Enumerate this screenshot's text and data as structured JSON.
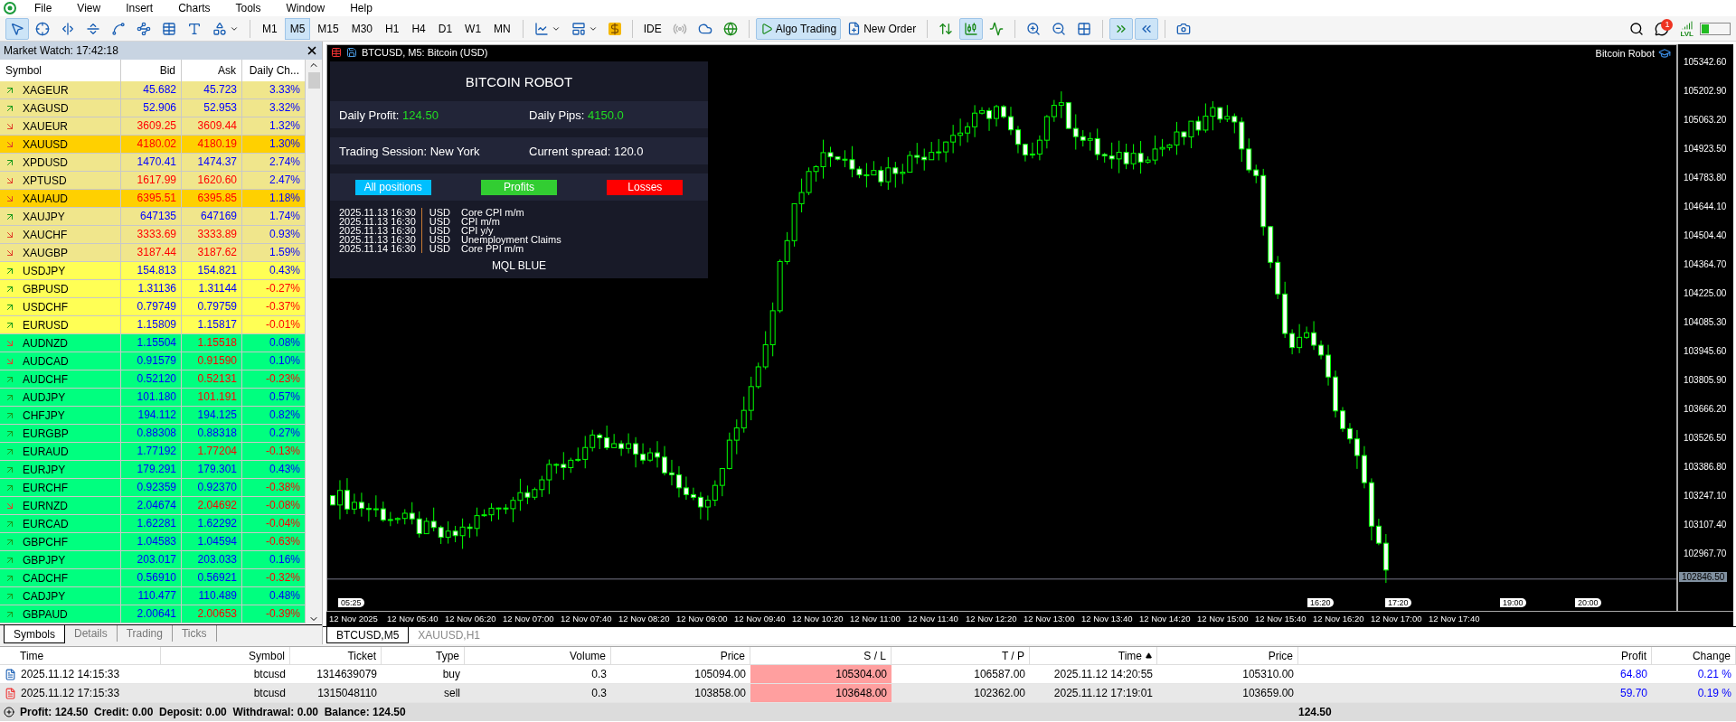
{
  "menu": [
    "File",
    "View",
    "Insert",
    "Charts",
    "Tools",
    "Window",
    "Help"
  ],
  "toolbar": {
    "cursor_selected": true,
    "timeframes": [
      {
        "label": "M1",
        "selected": false
      },
      {
        "label": "M5",
        "selected": true
      },
      {
        "label": "M15",
        "selected": false
      },
      {
        "label": "M30",
        "selected": false
      },
      {
        "label": "H1",
        "selected": false
      },
      {
        "label": "H4",
        "selected": false
      },
      {
        "label": "D1",
        "selected": false
      },
      {
        "label": "W1",
        "selected": false
      },
      {
        "label": "MN",
        "selected": false
      }
    ],
    "ide": "IDE",
    "algo_trading": "Algo Trading",
    "algo_trading_on": true,
    "new_order": "New Order",
    "candles_selected": true,
    "chart_shift": true,
    "autoscroll": true,
    "notification_count": "1",
    "signal_label": "LVL"
  },
  "market_watch": {
    "title": "Market Watch: 17:42:18",
    "columns": [
      "Symbol",
      "Bid",
      "Ask",
      "Daily Ch..."
    ],
    "rows": [
      {
        "symbol": "XAGEUR",
        "rising": true,
        "bid": "45.682",
        "bid_up": true,
        "ask": "45.723",
        "ask_up": true,
        "change": "3.33%",
        "change_up": true,
        "color": "#f0e68c"
      },
      {
        "symbol": "XAGUSD",
        "rising": true,
        "bid": "52.906",
        "bid_up": true,
        "ask": "52.953",
        "ask_up": true,
        "change": "3.32%",
        "change_up": true,
        "color": "#f0e68c"
      },
      {
        "symbol": "XAUEUR",
        "rising": false,
        "bid": "3609.25",
        "bid_up": false,
        "ask": "3609.44",
        "ask_up": false,
        "change": "1.32%",
        "change_up": true,
        "color": "#f0e68c"
      },
      {
        "symbol": "XAUUSD",
        "rising": false,
        "bid": "4180.02",
        "bid_up": false,
        "ask": "4180.19",
        "ask_up": false,
        "change": "1.30%",
        "change_up": true,
        "color": "#ffd000"
      },
      {
        "symbol": "XPDUSD",
        "rising": true,
        "bid": "1470.41",
        "bid_up": true,
        "ask": "1474.37",
        "ask_up": true,
        "change": "2.74%",
        "change_up": true,
        "color": "#f0e68c"
      },
      {
        "symbol": "XPTUSD",
        "rising": false,
        "bid": "1617.99",
        "bid_up": false,
        "ask": "1620.60",
        "ask_up": false,
        "change": "2.47%",
        "change_up": true,
        "color": "#f0e68c"
      },
      {
        "symbol": "XAUAUD",
        "rising": false,
        "bid": "6395.51",
        "bid_up": false,
        "ask": "6395.85",
        "ask_up": false,
        "change": "1.18%",
        "change_up": true,
        "color": "#ffd000"
      },
      {
        "symbol": "XAUJPY",
        "rising": true,
        "bid": "647135",
        "bid_up": true,
        "ask": "647169",
        "ask_up": true,
        "change": "1.74%",
        "change_up": true,
        "color": "#f0e68c"
      },
      {
        "symbol": "XAUCHF",
        "rising": false,
        "bid": "3333.69",
        "bid_up": false,
        "ask": "3333.89",
        "ask_up": false,
        "change": "0.93%",
        "change_up": true,
        "color": "#f0e68c"
      },
      {
        "symbol": "XAUGBP",
        "rising": false,
        "bid": "3187.44",
        "bid_up": false,
        "ask": "3187.62",
        "ask_up": false,
        "change": "1.59%",
        "change_up": true,
        "color": "#f0e68c"
      },
      {
        "symbol": "USDJPY",
        "rising": true,
        "bid": "154.813",
        "bid_up": true,
        "ask": "154.821",
        "ask_up": true,
        "change": "0.43%",
        "change_up": true,
        "color": "#ffff55"
      },
      {
        "symbol": "GBPUSD",
        "rising": true,
        "bid": "1.31136",
        "bid_up": true,
        "ask": "1.31144",
        "ask_up": true,
        "change": "-0.27%",
        "change_up": false,
        "color": "#ffff55"
      },
      {
        "symbol": "USDCHF",
        "rising": true,
        "bid": "0.79749",
        "bid_up": true,
        "ask": "0.79759",
        "ask_up": true,
        "change": "-0.37%",
        "change_up": false,
        "color": "#ffff55"
      },
      {
        "symbol": "EURUSD",
        "rising": true,
        "bid": "1.15809",
        "bid_up": true,
        "ask": "1.15817",
        "ask_up": true,
        "change": "-0.01%",
        "change_up": false,
        "color": "#ffff55"
      },
      {
        "symbol": "AUDNZD",
        "rising": false,
        "bid": "1.15504",
        "bid_up": true,
        "ask": "1.15518",
        "ask_up": false,
        "change": "0.08%",
        "change_up": true,
        "color": "#00ff7f"
      },
      {
        "symbol": "AUDCAD",
        "rising": false,
        "bid": "0.91579",
        "bid_up": true,
        "ask": "0.91590",
        "ask_up": false,
        "change": "0.10%",
        "change_up": true,
        "color": "#00ff7f"
      },
      {
        "symbol": "AUDCHF",
        "rising": true,
        "bid": "0.52120",
        "bid_up": true,
        "ask": "0.52131",
        "ask_up": false,
        "change": "-0.23%",
        "change_up": false,
        "color": "#00ff7f"
      },
      {
        "symbol": "AUDJPY",
        "rising": true,
        "bid": "101.180",
        "bid_up": true,
        "ask": "101.191",
        "ask_up": false,
        "change": "0.57%",
        "change_up": true,
        "color": "#00ff7f"
      },
      {
        "symbol": "CHFJPY",
        "rising": true,
        "bid": "194.112",
        "bid_up": true,
        "ask": "194.125",
        "ask_up": true,
        "change": "0.82%",
        "change_up": true,
        "color": "#00ff7f"
      },
      {
        "symbol": "EURGBP",
        "rising": true,
        "bid": "0.88308",
        "bid_up": true,
        "ask": "0.88318",
        "ask_up": true,
        "change": "0.27%",
        "change_up": true,
        "color": "#00ff7f"
      },
      {
        "symbol": "EURAUD",
        "rising": true,
        "bid": "1.77192",
        "bid_up": true,
        "ask": "1.77204",
        "ask_up": false,
        "change": "-0.13%",
        "change_up": false,
        "color": "#00ff7f"
      },
      {
        "symbol": "EURJPY",
        "rising": true,
        "bid": "179.291",
        "bid_up": true,
        "ask": "179.301",
        "ask_up": true,
        "change": "0.43%",
        "change_up": true,
        "color": "#00ff7f"
      },
      {
        "symbol": "EURCHF",
        "rising": true,
        "bid": "0.92359",
        "bid_up": true,
        "ask": "0.92370",
        "ask_up": true,
        "change": "-0.38%",
        "change_up": false,
        "color": "#00ff7f"
      },
      {
        "symbol": "EURNZD",
        "rising": false,
        "bid": "2.04674",
        "bid_up": true,
        "ask": "2.04692",
        "ask_up": false,
        "change": "-0.08%",
        "change_up": false,
        "color": "#00ff7f"
      },
      {
        "symbol": "EURCAD",
        "rising": true,
        "bid": "1.62281",
        "bid_up": true,
        "ask": "1.62292",
        "ask_up": true,
        "change": "-0.04%",
        "change_up": false,
        "color": "#00ff7f"
      },
      {
        "symbol": "GBPCHF",
        "rising": true,
        "bid": "1.04583",
        "bid_up": true,
        "ask": "1.04594",
        "ask_up": true,
        "change": "-0.63%",
        "change_up": false,
        "color": "#00ff7f"
      },
      {
        "symbol": "GBPJPY",
        "rising": true,
        "bid": "203.017",
        "bid_up": true,
        "ask": "203.033",
        "ask_up": true,
        "change": "0.16%",
        "change_up": true,
        "color": "#00ff7f"
      },
      {
        "symbol": "CADCHF",
        "rising": true,
        "bid": "0.56910",
        "bid_up": true,
        "ask": "0.56921",
        "ask_up": true,
        "change": "-0.32%",
        "change_up": false,
        "color": "#00ff7f"
      },
      {
        "symbol": "CADJPY",
        "rising": true,
        "bid": "110.477",
        "bid_up": true,
        "ask": "110.489",
        "ask_up": true,
        "change": "0.48%",
        "change_up": true,
        "color": "#00ff7f"
      },
      {
        "symbol": "GBPAUD",
        "rising": true,
        "bid": "2.00641",
        "bid_up": true,
        "ask": "2.00653",
        "ask_up": false,
        "change": "-0.39%",
        "change_up": false,
        "color": "#00ff7f"
      }
    ],
    "tabs": [
      {
        "label": "Symbols",
        "selected": true
      },
      {
        "label": "Details",
        "selected": false
      },
      {
        "label": "Trading",
        "selected": false
      },
      {
        "label": "Ticks",
        "selected": false
      }
    ]
  },
  "chart": {
    "title": "BTCUSD, M5:  Bitcoin (USD)",
    "robot_label": "Bitcoin Robot",
    "price_axis": [
      "105342.60",
      "105202.90",
      "105063.20",
      "104923.50",
      "104783.80",
      "104644.10",
      "104504.40",
      "104364.70",
      "104225.00",
      "104085.30",
      "103945.60",
      "103805.90",
      "103666.20",
      "103526.50",
      "103386.80",
      "103247.10",
      "103107.40",
      "102967.70"
    ],
    "current_price": "102846.50",
    "time_axis": [
      "12 Nov 2025",
      "12 Nov 05:40",
      "12 Nov 06:20",
      "12 Nov 07:00",
      "12 Nov 07:40",
      "12 Nov 08:20",
      "12 Nov 09:00",
      "12 Nov 09:40",
      "12 Nov 10:20",
      "12 Nov 11:00",
      "12 Nov 11:40",
      "12 Nov 12:20",
      "12 Nov 13:00",
      "12 Nov 13:40",
      "12 Nov 14:20",
      "12 Nov 15:00",
      "12 Nov 15:40",
      "12 Nov 16:20",
      "12 Nov 17:00",
      "12 Nov 17:40"
    ],
    "time_markers": [
      "05:25",
      "16:20",
      "17:20",
      "19:00",
      "20:00"
    ],
    "panel": {
      "title": "BITCOIN ROBOT",
      "profit_label": "Daily Profit:",
      "profit_value": "124.50",
      "pips_label": "Daily Pips:",
      "pips_value": "4150.0",
      "session": "Trading Session: New York",
      "spread": "Current spread: 120.0",
      "buttons": [
        {
          "label": "All positions",
          "color": "#00bfff"
        },
        {
          "label": "Profits",
          "color": "#32cd32"
        },
        {
          "label": "Losses",
          "color": "#ff0000"
        }
      ],
      "news": [
        {
          "date": "2025.11.13 16:30",
          "currency": "USD",
          "event": "Core CPI m/m"
        },
        {
          "date": "2025.11.13 16:30",
          "currency": "USD",
          "event": "CPI m/m"
        },
        {
          "date": "2025.11.13 16:30",
          "currency": "USD",
          "event": "CPI y/y"
        },
        {
          "date": "2025.11.13 16:30",
          "currency": "USD",
          "event": "Unemployment Claims"
        },
        {
          "date": "2025.11.14 16:30",
          "currency": "USD",
          "event": "Core PPI m/m"
        }
      ],
      "footer": "MQL BLUE"
    },
    "tabs": [
      {
        "label": "BTCUSD,M5",
        "selected": true
      },
      {
        "label": "XAUUSD,H1",
        "selected": false
      }
    ]
  },
  "trades": {
    "columns": [
      {
        "label": "Time",
        "sorted": false
      },
      {
        "label": "Symbol",
        "sorted": false
      },
      {
        "label": "Ticket",
        "sorted": false
      },
      {
        "label": "Type",
        "sorted": false
      },
      {
        "label": "Volume",
        "sorted": false
      },
      {
        "label": "Price",
        "sorted": false
      },
      {
        "label": "S / L",
        "sorted": false
      },
      {
        "label": "T / P",
        "sorted": false
      },
      {
        "label": "Time",
        "sorted": true
      },
      {
        "label": "Price",
        "sorted": false
      },
      {
        "label": "Profit",
        "sorted": false
      },
      {
        "label": "Change",
        "sorted": false
      }
    ],
    "rows": [
      {
        "kind": "buy",
        "selected": false,
        "sl_highlighted": true,
        "cells": [
          "2025.11.12 14:15:33",
          "btcusd",
          "1314639079",
          "buy",
          "0.3",
          "105094.00",
          "105304.00",
          "106587.00",
          "2025.11.12 14:20:55",
          "105310.00",
          "64.80",
          "0.21 %"
        ]
      },
      {
        "kind": "sell",
        "selected": true,
        "sl_highlighted": true,
        "cells": [
          "2025.11.12 17:15:33",
          "btcusd",
          "1315048110",
          "sell",
          "0.3",
          "103858.00",
          "103648.00",
          "102362.00",
          "2025.11.12 17:19:01",
          "103659.00",
          "59.70",
          "0.19 %"
        ]
      }
    ],
    "summary": "Profit: 124.50  Credit: 0.00  Deposit: 0.00  Withdrawal: 0.00  Balance: 124.50",
    "total": "124.50"
  }
}
